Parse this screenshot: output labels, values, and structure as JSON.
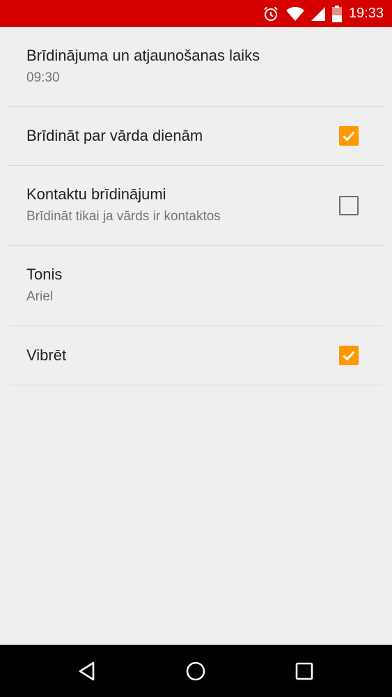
{
  "status_bar": {
    "time": "19:33",
    "icons": [
      "alarm-icon",
      "wifi-icon",
      "signal-icon",
      "battery-icon"
    ],
    "background": "#d50000"
  },
  "settings": {
    "alert_time": {
      "title": "Brīdinājuma un atjaunošanas laiks",
      "summary": "09:30"
    },
    "name_days": {
      "title": "Brīdināt par vārda dienām",
      "checked": true
    },
    "contact_alerts": {
      "title": "Kontaktu brīdinājumi",
      "summary": "Brīdināt tikai ja vārds ir kontaktos",
      "checked": false
    },
    "ringtone": {
      "title": "Tonis",
      "summary": "Ariel"
    },
    "vibrate": {
      "title": "Vibrēt",
      "checked": true
    }
  },
  "colors": {
    "accent": "#ff9800",
    "background": "#efefef",
    "divider": "#d9d9d9"
  },
  "nav_bar": {
    "icons": [
      "back-icon",
      "home-icon",
      "recents-icon"
    ]
  }
}
